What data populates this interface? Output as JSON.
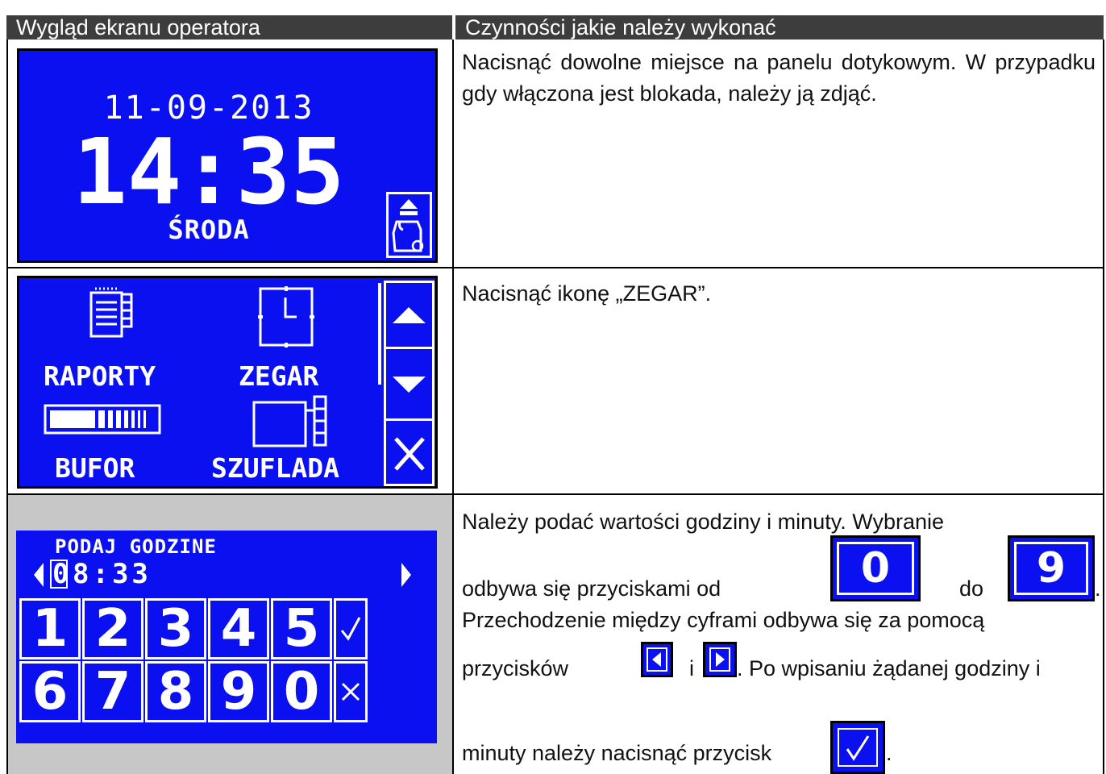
{
  "header": {
    "col1": "Wygląd ekranu operatora",
    "col2": "Czynności jakie należy wykonać"
  },
  "row1": {
    "screen": {
      "date": "11-09-2013",
      "time": "14:35",
      "day": "ŚRODA",
      "lock_icon": "lock-icon"
    },
    "instruction": "Nacisnąć dowolne miejsce na panelu dotykowym. W przypadku gdy włączona jest blokada, należy ją zdjąć."
  },
  "row2": {
    "screen": {
      "items": [
        "RAPORTY",
        "ZEGAR",
        "BUFOR",
        "SZUFLADA"
      ],
      "sidebar": [
        "arrow-up-icon",
        "arrow-down-icon",
        "close-icon"
      ]
    },
    "instruction": "Nacisnąć ikonę „ZEGAR”."
  },
  "row3": {
    "screen": {
      "title": "PODAJ GODZINE",
      "first_digit": "0",
      "value_rest": "8:33",
      "keys_row1": [
        "1",
        "2",
        "3",
        "4",
        "5"
      ],
      "keys_row2": [
        "6",
        "7",
        "8",
        "9",
        "0"
      ],
      "confirm_icon": "check-icon",
      "cancel_icon": "close-icon"
    },
    "instruction": {
      "line1": "Należy podać wartości godziny i minuty. Wybranie",
      "line2_a": "odbywa się przyciskami od",
      "icon_from": "0",
      "line2_b": "do",
      "icon_to": "9",
      "line2_end": ".",
      "line3": "Przechodzenie między cyframi odbywa się za pomocą",
      "line4_a": "przycisków",
      "line4_b": "i",
      "line4_c": ". Po wpisaniu żądanej godziny i",
      "line5_a": "minuty należy nacisnąć przycisk",
      "line5_end": "."
    }
  }
}
